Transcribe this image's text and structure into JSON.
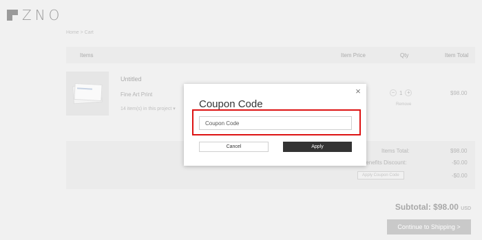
{
  "brand": {
    "logo_text": "ZNO"
  },
  "breadcrumb": "Home > Cart",
  "table": {
    "headers": {
      "items": "Items",
      "price": "Item Price",
      "qty": "Qty",
      "total": "Item Total"
    }
  },
  "cart_item": {
    "title": "Untitled",
    "type": "Fine Art Print",
    "project_count": "14 item(s) in this project",
    "quantity": "1",
    "qty_minus": "−",
    "qty_plus": "+",
    "remove_label": "Remove",
    "total": "$98.00"
  },
  "summary": {
    "items_total_label": "Items Total:",
    "items_total_value": "$98.00",
    "benefits_label": "Benefits Discount:",
    "benefits_value": "-$0.00",
    "apply_coupon_label": "Apply Coupon Code",
    "coupon_value": "-$0.00"
  },
  "subtotal": {
    "label": "Subtotal:",
    "value": "$98.00",
    "currency": "USD"
  },
  "continue_label": "Continue to Shipping >",
  "modal": {
    "title": "Coupon Code",
    "close_glyph": "×",
    "input_placeholder": "Coupon Code",
    "input_value": "",
    "cancel_label": "Cancel",
    "apply_label": "Apply"
  },
  "colors": {
    "highlight": "#dd1111",
    "apply_button": "#333333"
  },
  "icons": {
    "close": "close-icon",
    "dropdown": "chevron-down-icon"
  }
}
